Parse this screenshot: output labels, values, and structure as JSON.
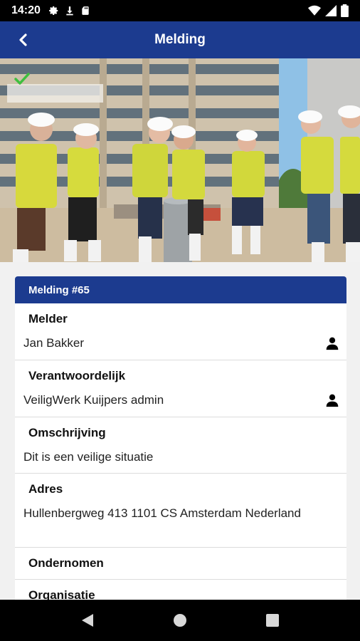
{
  "status_bar": {
    "time": "14:20",
    "left_icons": [
      "gear-icon",
      "download-icon",
      "sd-card-icon"
    ],
    "right_icons": [
      "wifi-icon",
      "signal-icon",
      "battery-icon"
    ]
  },
  "app_bar": {
    "title": "Melding",
    "back_icon": "arrow-left-icon"
  },
  "hero": {
    "status_icon": "checkmark-icon",
    "status_color": "#3fbf3f"
  },
  "card": {
    "header": "Melding #65",
    "fields": [
      {
        "label": "Melder",
        "value": "Jan Bakker",
        "icon": "person-icon"
      },
      {
        "label": "Verantwoordelijk",
        "value": "VeiligWerk Kuijpers admin",
        "icon": "person-icon"
      },
      {
        "label": "Omschrijving",
        "value": "Dit is een veilige situatie"
      },
      {
        "label": "Adres",
        "value": "Hullenbergweg 413 1101 CS Amsterdam Nederland"
      },
      {
        "label": "Ondernomen",
        "value": ""
      },
      {
        "label": "Organisatie",
        "value": ""
      }
    ]
  },
  "colors": {
    "primary": "#1c3b8f",
    "background": "#f1f1f1"
  },
  "nav_bar": {
    "icons": [
      "back-triangle-icon",
      "home-circle-icon",
      "recents-square-icon"
    ]
  }
}
